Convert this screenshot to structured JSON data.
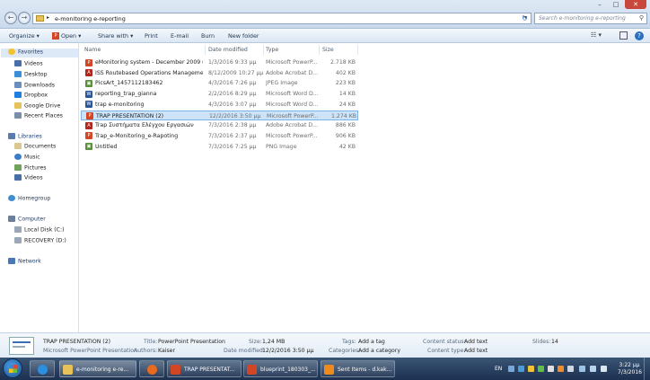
{
  "window": {
    "address_path": "e-monitoring e-reporting",
    "search_placeholder": "Search e-monitoring e-reporting",
    "minimize": "–",
    "maximize": "□",
    "close": "✕"
  },
  "toolbar": {
    "organize": "Organize ▾",
    "open": "Open ▾",
    "share_with": "Share with ▾",
    "print": "Print",
    "email": "E-mail",
    "burn": "Burn",
    "new_folder": "New folder"
  },
  "nav": {
    "favorites": "Favorites",
    "videos_fav": "Videos",
    "desktop": "Desktop",
    "downloads": "Downloads",
    "dropbox": "Dropbox",
    "google_drive": "Google Drive",
    "recent_places": "Recent Places",
    "libraries": "Libraries",
    "documents": "Documents",
    "music": "Music",
    "pictures": "Pictures",
    "videos_lib": "Videos",
    "homegroup": "Homegroup",
    "computer": "Computer",
    "local_disk": "Local Disk (C:)",
    "recovery": "RECOVERY (D:)",
    "network": "Network"
  },
  "columns": {
    "name": "Name",
    "date_modified": "Date modified",
    "type": "Type",
    "size": "Size"
  },
  "files": [
    {
      "name": "eMonitoring system - December 2009 up...",
      "date": "1/3/2016 9:33 μμ",
      "type": "Microsoft PowerP...",
      "size": "2.718 KB",
      "icon": "ppt",
      "color": "#d24625"
    },
    {
      "name": "ISS Routebased Operations Management...",
      "date": "8/12/2009 10:27 μμ",
      "type": "Adobe Acrobat D...",
      "size": "402 KB",
      "icon": "pdf",
      "color": "#b3261e"
    },
    {
      "name": "PicsArt_1457112183462",
      "date": "4/3/2016 7:26 μμ",
      "type": "JPEG Image",
      "size": "223 KB",
      "icon": "img",
      "color": "#5b8f3a"
    },
    {
      "name": "reporting_trap_gianna",
      "date": "2/2/2016 8:29 μμ",
      "type": "Microsoft Word D...",
      "size": "14 KB",
      "icon": "doc",
      "color": "#2b5797"
    },
    {
      "name": "trap e-monitoring",
      "date": "4/3/2016 3:07 μμ",
      "type": "Microsoft Word D...",
      "size": "24 KB",
      "icon": "doc",
      "color": "#2b5797"
    },
    {
      "name": "TRAP PRESENTATION (2)",
      "date": "12/2/2016 3:50 μμ",
      "type": "Microsoft PowerP...",
      "size": "1.274 KB",
      "icon": "ppt",
      "color": "#d24625"
    },
    {
      "name": "Trap Συστήματα Ελέγχου Εργασιών",
      "date": "7/3/2016 2:38 μμ",
      "type": "Adobe Acrobat D...",
      "size": "886 KB",
      "icon": "pdf",
      "color": "#b3261e"
    },
    {
      "name": "Trap_e-Monitoring_e-Rapoting",
      "date": "7/3/2016 2:37 μμ",
      "type": "Microsoft PowerP...",
      "size": "906 KB",
      "icon": "ppt",
      "color": "#d24625"
    },
    {
      "name": "Untitled",
      "date": "7/3/2016 7:25 μμ",
      "type": "PNG Image",
      "size": "42 KB",
      "icon": "img",
      "color": "#5b8f3a"
    }
  ],
  "details": {
    "file_name": "TRAP PRESENTATION (2)",
    "file_kind": "Microsoft PowerPoint Presentation",
    "title_label": "Title:",
    "title_value": "PowerPoint Presentation",
    "authors_label": "Authors:",
    "authors_value": "Kaiser",
    "size_label": "Size:",
    "size_value": "1,24 MB",
    "date_label": "Date modified:",
    "date_value": "12/2/2016 3:50 μμ",
    "tags_label": "Tags:",
    "tags_value": "Add a tag",
    "categories_label": "Categories:",
    "categories_value": "Add a category",
    "content_status_label": "Content status:",
    "content_status_value": "Add text",
    "content_type_label": "Content type:",
    "content_type_value": "Add text",
    "slides_label": "Slides:",
    "slides_value": "14"
  },
  "taskbar": {
    "explorer": "e-monitoring e-re...",
    "ppt1": "TRAP PRESENTAT...",
    "ppt2": "blueprint_180303_...",
    "outlook": "Sent Items - d.kak...",
    "lang": "EN",
    "time": "3:22 μμ",
    "date": "7/3/2016"
  }
}
